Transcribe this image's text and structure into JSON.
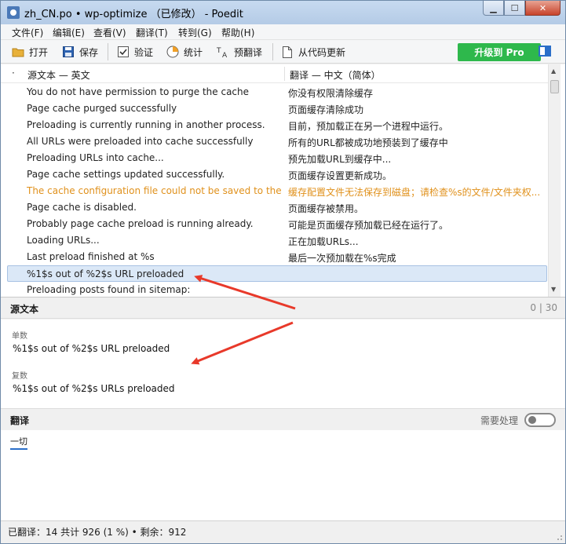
{
  "window": {
    "title": "zh_CN.po • wp-optimize （已修改） - Poedit",
    "controls": {
      "minimize": "▁",
      "maximize": "☐",
      "close": "✕"
    }
  },
  "menu": {
    "items": [
      "文件(F)",
      "编辑(E)",
      "查看(V)",
      "翻译(T)",
      "转到(G)",
      "帮助(H)"
    ]
  },
  "toolbar": {
    "open_label": "打开",
    "save_label": "保存",
    "validate_label": "验证",
    "stats_label": "统计",
    "pretranslate_label": "预翻译",
    "update_from_code_label": "从代码更新",
    "pro_label": "升级到 Pro",
    "icons": {
      "open": "folder-icon",
      "save": "floppy-disk-icon",
      "validate": "checkbox-icon",
      "stats": "pie-chart-icon",
      "pretranslate": "translate-icon",
      "update": "document-icon",
      "sidebar": "sidebar-toggle-icon"
    },
    "pro_color": "#2eb84c"
  },
  "list": {
    "sort_indicator": "·",
    "source_header": "源文本 — 英文",
    "translation_header": "翻译 — 中文（简体）",
    "rows": [
      {
        "source": "You do not have permission to purge the cache",
        "translation": "你没有权限清除缓存"
      },
      {
        "source": "Page cache purged successfully",
        "translation": "页面缓存清除成功"
      },
      {
        "source": "Preloading is currently running in another process.",
        "translation": "目前，预加载正在另一个进程中运行。"
      },
      {
        "source": "All URLs were preloaded into cache successfully",
        "translation": "所有的URL都被成功地预装到了缓存中"
      },
      {
        "source": "Preloading URLs into cache...",
        "translation": "预先加载URL到缓存中..."
      },
      {
        "source": "Page cache settings updated successfully.",
        "translation": "页面缓存设置更新成功。"
      },
      {
        "source": "The cache configuration file could not be saved to the ...",
        "translation": "缓存配置文件无法保存到磁盘；请检查%s的文件/文件夹权...",
        "warning": true
      },
      {
        "source": "Page cache is disabled.",
        "translation": "页面缓存被禁用。"
      },
      {
        "source": "Probably page cache preload is running already.",
        "translation": "可能是页面缓存预加载已经在运行了。"
      },
      {
        "source": "Loading URLs...",
        "translation": "正在加载URLs..."
      },
      {
        "source": "Last preload finished at %s",
        "translation": "最后一次预加载在%s完成"
      },
      {
        "source": "%1$s out of %2$s URL preloaded",
        "translation": "",
        "selected": true
      },
      {
        "source": "Preloading posts found in sitemap:",
        "translation": ""
      }
    ],
    "warning_color": "#e0911c"
  },
  "source_panel": {
    "label": "源文本",
    "counter": "0 | 30",
    "singular_label": "单数",
    "singular_text": "%1$s out of %2$s URL preloaded",
    "plural_label": "复数",
    "plural_text": "%1$s out of %2$s URLs preloaded"
  },
  "translation_panel": {
    "label": "翻译",
    "needs_work_label": "需要处理",
    "needs_work_on": false,
    "tab_label": "一切"
  },
  "status": {
    "text": "已翻译：14 共计 926 (1 %)  •  剩余：912"
  },
  "annotation_color": "#e8392a"
}
